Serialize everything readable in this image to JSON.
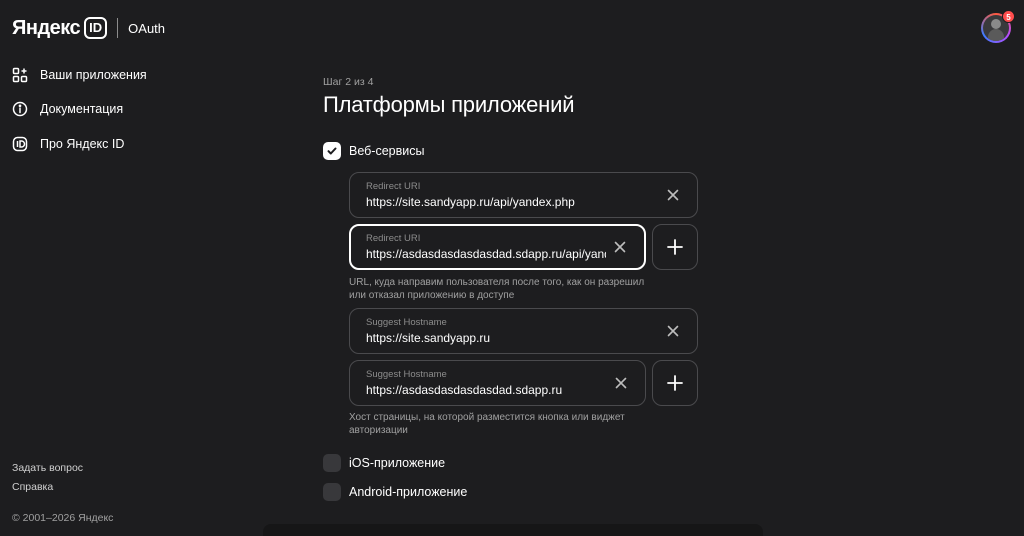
{
  "header": {
    "logo_text": "Яндекс",
    "logo_id": "ID",
    "service": "OAuth",
    "notifications_count": "5"
  },
  "sidebar": {
    "items": [
      {
        "label": "Ваши приложения",
        "icon": "apps-grid-plus-icon"
      },
      {
        "label": "Документация",
        "icon": "info-circle-icon"
      },
      {
        "label": "Про Яндекс ID",
        "icon": "id-badge-icon"
      }
    ],
    "footer": {
      "ask_question": "Задать вопрос",
      "help": "Справка",
      "copyright": "© 2001–2026 Яндекс"
    }
  },
  "main": {
    "step": "Шаг 2 из 4",
    "title": "Платформы приложений",
    "web": {
      "label": "Веб-сервисы",
      "checked": true,
      "redirect_uris": [
        {
          "label": "Redirect URI",
          "value": "https://site.sandyapp.ru/api/yandex.php"
        },
        {
          "label": "Redirect URI",
          "value": "https://asdasdasdasdasdad.sdapp.ru/api/yandex.php"
        }
      ],
      "redirect_hint": "URL, куда направим пользователя после того, как он разрешил или отказал приложению в доступе",
      "suggest_hostnames": [
        {
          "label": "Suggest Hostname",
          "value": "https://site.sandyapp.ru"
        },
        {
          "label": "Suggest Hostname",
          "value": "https://asdasdasdasdasdad.sdapp.ru"
        }
      ],
      "hostname_hint": "Хост страницы, на которой разместится кнопка или виджет авторизации"
    },
    "ios": {
      "label": "iOS-приложение",
      "checked": false
    },
    "android": {
      "label": "Android-приложение",
      "checked": false
    }
  },
  "colors": {
    "background": "#1d1d1f",
    "field_border": "#4a4a4d",
    "active_border": "#ffffff",
    "muted_text": "#a0a0a0",
    "badge": "#ff4d4d"
  }
}
